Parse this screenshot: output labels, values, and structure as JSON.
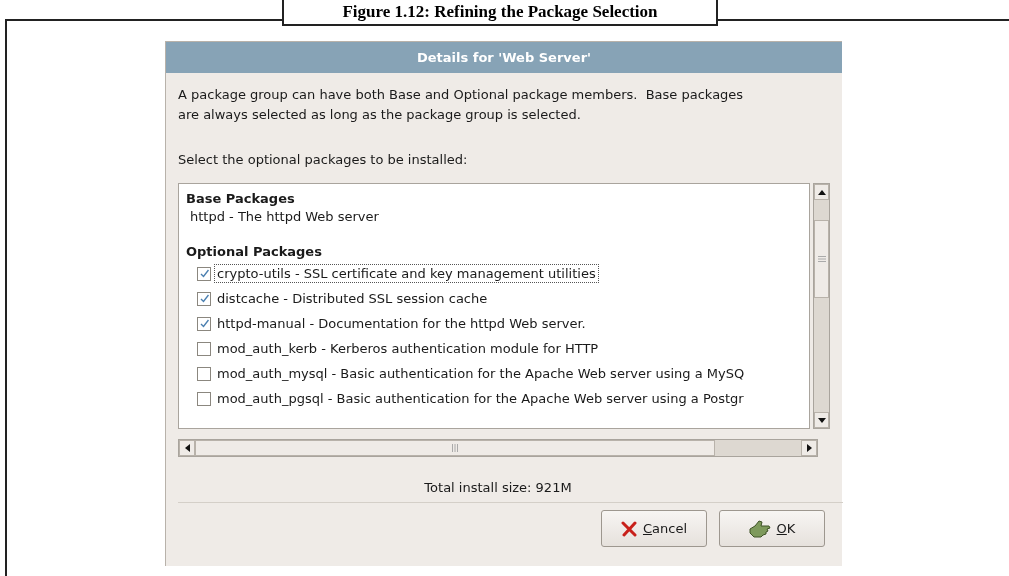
{
  "figure": {
    "caption": "Figure 1.12: Refining the Package Selection"
  },
  "dialog": {
    "title": "Details for 'Web Server'",
    "description": "A package group can have both Base and Optional package members.  Base packages are always selected as long as the package group is selected.",
    "prompt": "Select the optional packages to be installed:",
    "sections": [
      {
        "heading": "Base Packages",
        "items": [
          {
            "kind": "plain",
            "label": "httpd - The httpd Web server"
          }
        ]
      },
      {
        "heading": "Optional Packages",
        "items": [
          {
            "kind": "checkbox",
            "label": "crypto-utils - SSL certificate and key management utilities",
            "checked": true,
            "focused": true
          },
          {
            "kind": "checkbox",
            "label": "distcache - Distributed SSL session cache",
            "checked": true,
            "focused": false
          },
          {
            "kind": "checkbox",
            "label": "httpd-manual - Documentation for the httpd Web server.",
            "checked": true,
            "focused": false
          },
          {
            "kind": "checkbox",
            "label": "mod_auth_kerb - Kerberos authentication module for HTTP",
            "checked": false,
            "focused": false
          },
          {
            "kind": "checkbox",
            "label": "mod_auth_mysql - Basic authentication for the Apache Web server using a MySQ",
            "checked": false,
            "focused": false
          },
          {
            "kind": "checkbox",
            "label": "mod_auth_pgsql - Basic authentication for the Apache Web server using a Postgr",
            "checked": false,
            "focused": false
          }
        ]
      }
    ],
    "total": "Total install size: 921M",
    "buttons": [
      {
        "kind": "cancel",
        "mnemonic": "C",
        "rest": "ancel"
      },
      {
        "kind": "ok",
        "mnemonic": "O",
        "rest": "K"
      }
    ]
  }
}
